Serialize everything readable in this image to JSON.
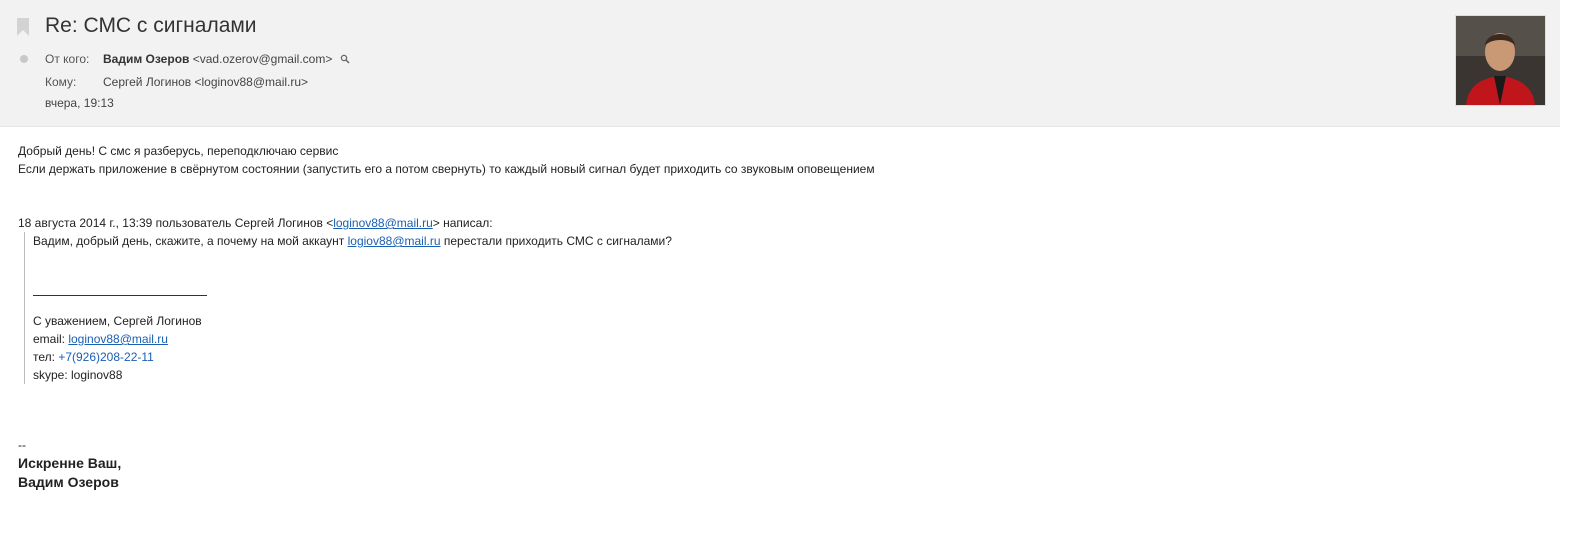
{
  "header": {
    "subject": "Re: СМС с сигналами",
    "from_label": "От кого:",
    "from_name": "Вадим Озеров",
    "from_email": "<vad.ozerov@gmail.com>",
    "to_label": "Кому:",
    "to_value": "Сергей Логинов <loginov88@mail.ru>",
    "date": "вчера, 19:13"
  },
  "message": {
    "line1": "Добрый день! С смс я разберусь, переподключаю сервис",
    "line2": "Если держать приложение в свёрнутом состоянии (запустить его а потом свернуть) то каждый новый сигнал будет приходить со звуковым оповещением",
    "quote_header_pre": "18 августа 2014 г., 13:39 пользователь Сергей Логинов <",
    "quote_header_link": "loginov88@mail.ru",
    "quote_header_post": "> написал:",
    "quote_line_pre": "Вадим, добрый день, скажите, а почему на мой аккаунт ",
    "quote_line_link": "logiov88@mail.ru",
    "quote_line_post": " перестали приходить СМС с сигналами?",
    "regards": "С уважением, Сергей Логинов",
    "email_label": "email: ",
    "email_link": "loginov88@mail.ru",
    "tel_label": "тел: ",
    "tel_link": "+7(926)208-22-11",
    "skype": "skype: loginov88",
    "sig_dashes": "--",
    "sig_line1": "Искренне Ваш,",
    "sig_line2": "Вадим Озеров"
  },
  "icons": {
    "bookmark": "bookmark-icon",
    "status": "unread-dot-icon",
    "search": "search-icon"
  }
}
